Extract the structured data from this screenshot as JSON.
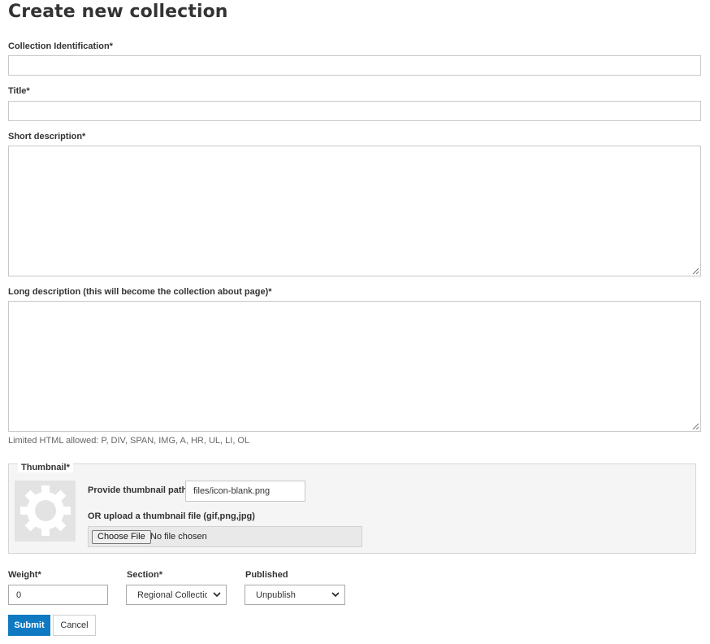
{
  "page": {
    "title": "Create new collection"
  },
  "fields": {
    "collection_id": {
      "label": "Collection Identification*",
      "value": ""
    },
    "title": {
      "label": "Title*",
      "value": ""
    },
    "short_description": {
      "label": "Short description*",
      "value": ""
    },
    "long_description": {
      "label": "Long description (this will become the collection about page)*",
      "value": ""
    },
    "html_help": "Limited HTML allowed: P, DIV, SPAN, IMG, A, HR, UL, LI, OL"
  },
  "thumbnail": {
    "legend": "Thumbnail*",
    "preview_icon": "gear-icon",
    "path_label": "Provide thumbnail path",
    "path_value": "files/icon-blank.png",
    "upload_label": "OR upload a thumbnail file (gif,png,jpg)",
    "choose_button": "Choose File",
    "file_status": "No file chosen"
  },
  "weight": {
    "label": "Weight*",
    "value": "0"
  },
  "section": {
    "label": "Section*",
    "selected": "Regional Collections"
  },
  "published": {
    "label": "Published",
    "selected": "Unpublish"
  },
  "actions": {
    "submit": "Submit",
    "cancel": "Cancel"
  },
  "colors": {
    "primary": "#0f7ac2",
    "border": "#c8c8c8",
    "fieldset_bg": "#f5f5f5"
  }
}
